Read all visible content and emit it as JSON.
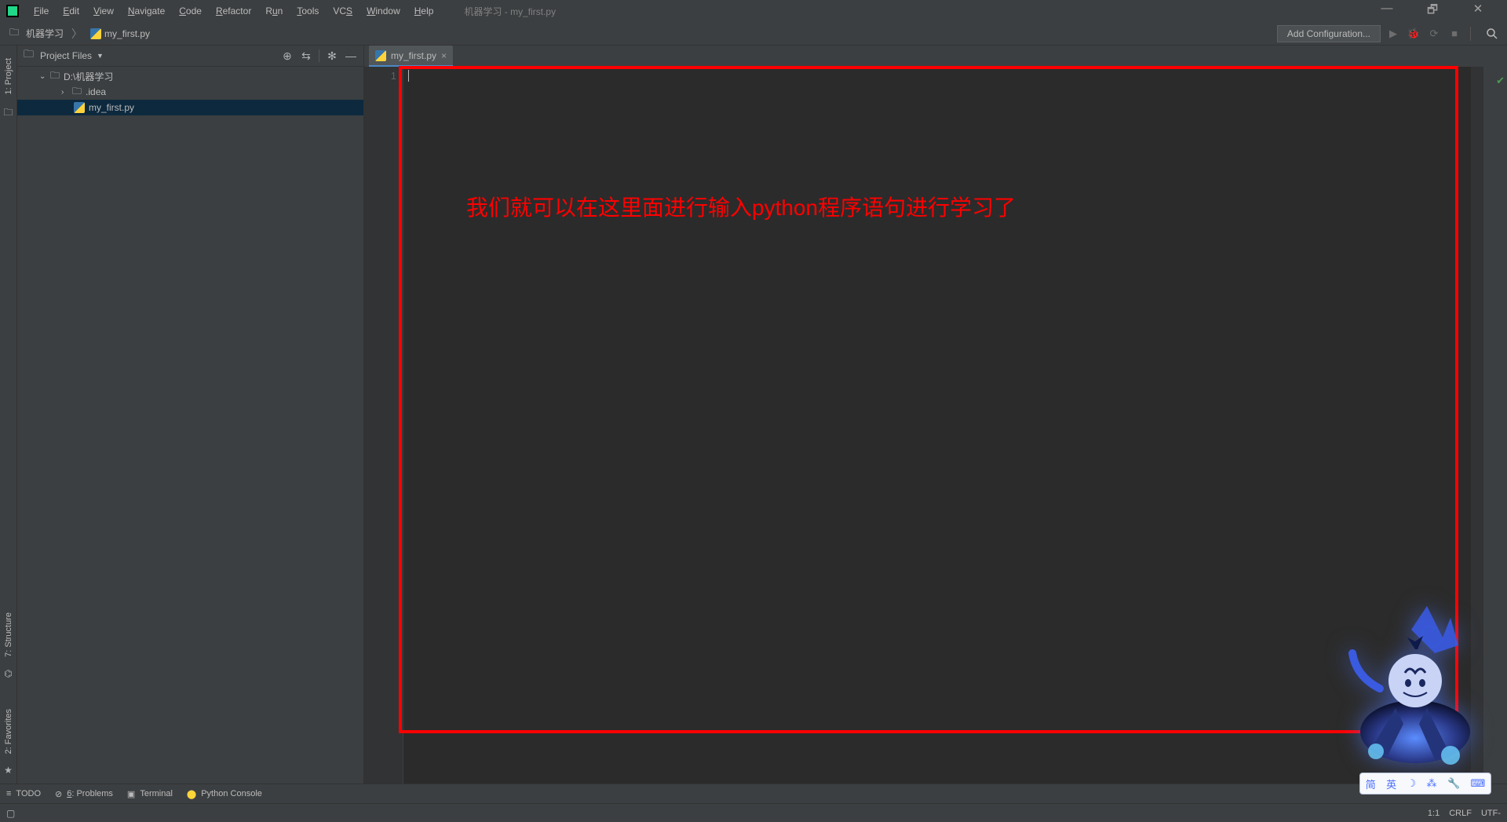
{
  "window": {
    "title": "机器学习 - my_first.py",
    "controls": {
      "minimize": "—",
      "maximize": "🗗",
      "close": "✕"
    }
  },
  "menubar": {
    "items": [
      {
        "pre": "",
        "key": "F",
        "post": "ile"
      },
      {
        "pre": "",
        "key": "E",
        "post": "dit"
      },
      {
        "pre": "",
        "key": "V",
        "post": "iew"
      },
      {
        "pre": "",
        "key": "N",
        "post": "avigate"
      },
      {
        "pre": "",
        "key": "C",
        "post": "ode"
      },
      {
        "pre": "",
        "key": "R",
        "post": "efactor"
      },
      {
        "pre": "R",
        "key": "u",
        "post": "n"
      },
      {
        "pre": "",
        "key": "T",
        "post": "ools"
      },
      {
        "pre": "VC",
        "key": "S",
        "post": ""
      },
      {
        "pre": "",
        "key": "W",
        "post": "indow"
      },
      {
        "pre": "",
        "key": "H",
        "post": "elp"
      }
    ]
  },
  "breadcrumb": {
    "project": "机器学习",
    "file": "my_first.py"
  },
  "toolbar": {
    "add_config": "Add Configuration..."
  },
  "left_gutter": {
    "tabs": [
      "1: Project",
      "7: Structure",
      "2: Favorites"
    ]
  },
  "project_panel": {
    "header": "Project Files",
    "root": "D:\\机器学习",
    "idea": ".idea",
    "file": "my_first.py"
  },
  "editor": {
    "tab_name": "my_first.py",
    "line_number": "1",
    "annotation": "我们就可以在这里面进行输入python程序语句进行学习了"
  },
  "bottom_bar": {
    "todo": "TODO",
    "problems_key": "6",
    "problems": ": Problems",
    "terminal": "Terminal",
    "python_console": "Python Console"
  },
  "status": {
    "position": "1:1",
    "line_sep": "CRLF",
    "encoding": "UTF-"
  },
  "ime": {
    "items": [
      "简",
      "英",
      "☽",
      "⁂",
      "🔧",
      "⌨"
    ]
  }
}
